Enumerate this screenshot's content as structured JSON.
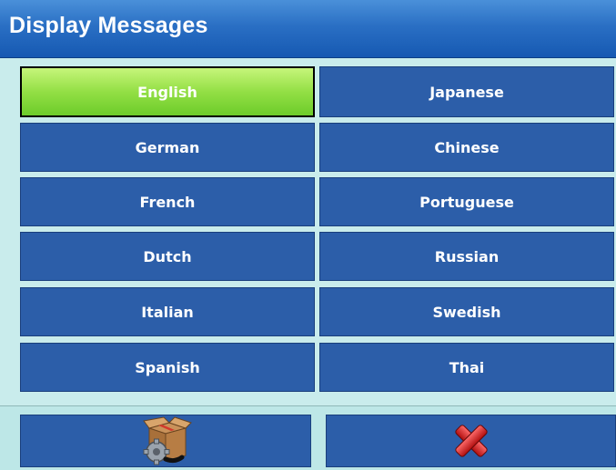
{
  "header": {
    "title": "Display Messages"
  },
  "languages": {
    "left": [
      "English",
      "German",
      "French",
      "Dutch",
      "Italian",
      "Spanish"
    ],
    "right": [
      "Japanese",
      "Chinese",
      "Portuguese",
      "Russian",
      "Swedish",
      "Thai"
    ]
  },
  "selected_language": "English",
  "footer": {
    "actions": [
      {
        "icon": "box-gear-icon"
      },
      {
        "icon": "red-x-icon"
      }
    ]
  },
  "colors": {
    "title_bar": "#1659b2",
    "button": "#2c5ea9",
    "selected": "#93df45",
    "background": "#c9ecec"
  }
}
